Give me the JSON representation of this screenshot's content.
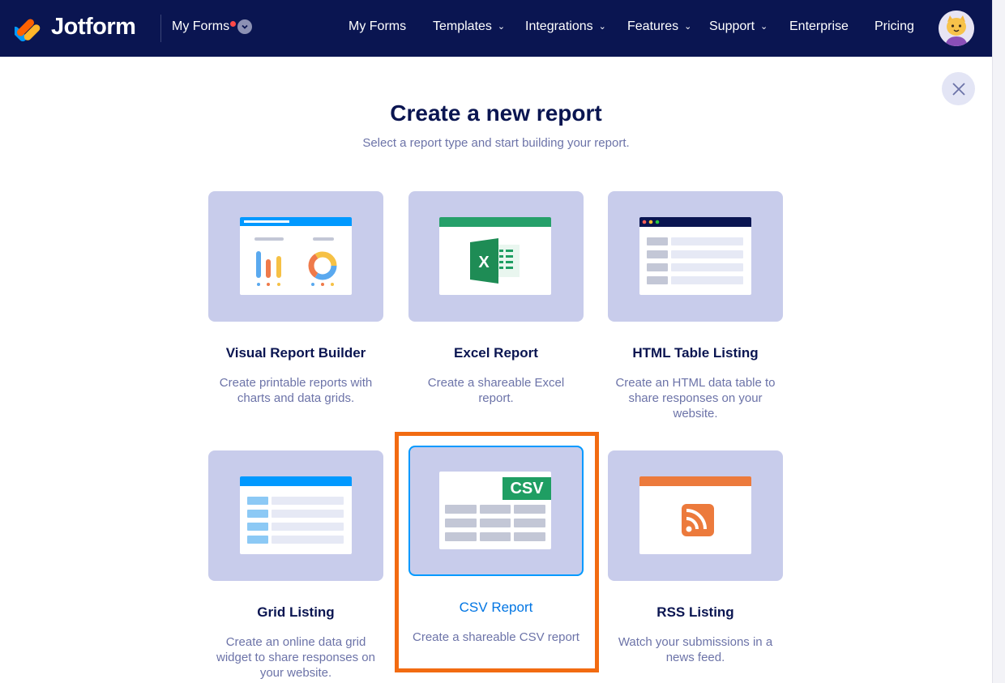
{
  "header": {
    "brand": "Jotform",
    "switcher_label": "My Forms",
    "nav": [
      {
        "label": "My Forms",
        "has_caret": false
      },
      {
        "label": "Templates",
        "has_caret": true
      },
      {
        "label": "Integrations",
        "has_caret": true
      },
      {
        "label": "Features",
        "has_caret": true
      },
      {
        "label": "Support",
        "has_caret": true
      },
      {
        "label": "Enterprise",
        "has_caret": false
      },
      {
        "label": "Pricing",
        "has_caret": false
      }
    ],
    "caret_glyph": "⌄"
  },
  "modal": {
    "title": "Create a new report",
    "subtitle": "Select a report type and start building your report."
  },
  "cards": [
    {
      "name": "Visual Report Builder",
      "desc": "Create printable reports with charts and data grids.",
      "icon": "chart-report-icon"
    },
    {
      "name": "Excel Report",
      "desc": "Create a shareable Excel report.",
      "icon": "excel-icon"
    },
    {
      "name": "HTML Table Listing",
      "desc": "Create an HTML data table to share responses on your website.",
      "icon": "html-table-icon"
    },
    {
      "name": "Grid Listing",
      "desc": "Create an online data grid widget to share responses on your website.",
      "icon": "grid-icon"
    },
    {
      "name": "CSV Report",
      "desc": "Create a shareable CSV report",
      "icon": "csv-icon",
      "badge": "CSV",
      "selected": true
    },
    {
      "name": "RSS Listing",
      "desc": "Watch your submissions in a news feed.",
      "icon": "rss-icon"
    }
  ],
  "colors": {
    "navy": "#0a1551",
    "card_bg": "#c8cceb",
    "selected_border": "#0099ff",
    "highlight": "#f26b11",
    "excel_green": "#1f9e63",
    "rss_orange": "#ec7a3c"
  }
}
